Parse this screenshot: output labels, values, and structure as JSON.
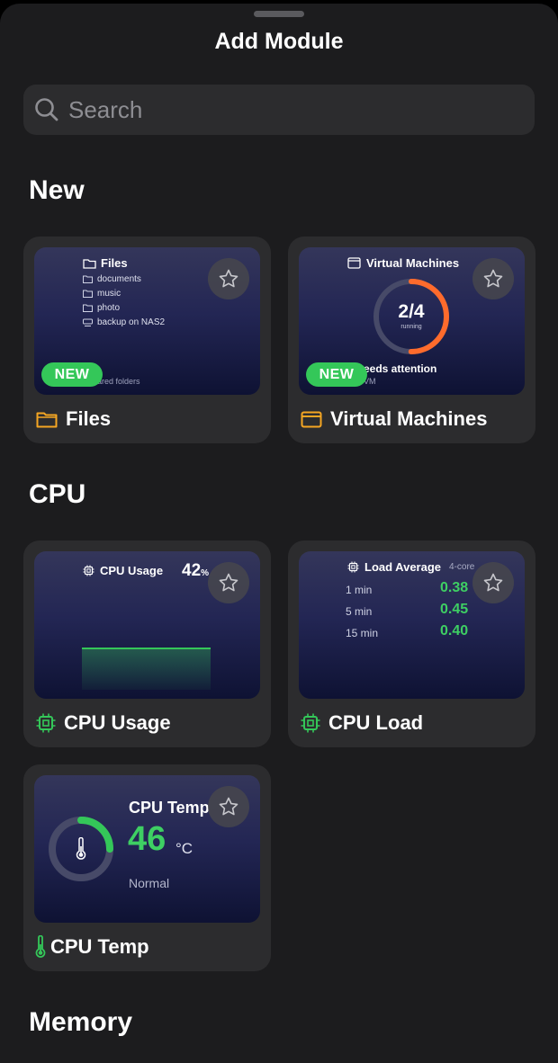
{
  "sheet": {
    "title": "Add Module"
  },
  "search": {
    "placeholder": "Search"
  },
  "sections": {
    "new": "New",
    "cpu": "CPU",
    "memory": "Memory"
  },
  "badges": {
    "new": "NEW"
  },
  "files_card": {
    "label": "Files",
    "preview_title": "Files",
    "folders": [
      "documents",
      "music",
      "photo",
      "backup on NAS2"
    ],
    "footer": "ared folders",
    "icon": "folder-icon"
  },
  "vm_card": {
    "label": "Virtual Machines",
    "preview_title": "Virtual Machines",
    "ring_value": "2/4",
    "ring_caption": "running",
    "ring_fraction": 0.5,
    "status_text": "eeds attention",
    "status_sub": "VM",
    "icon": "window-icon"
  },
  "cpu_usage_card": {
    "label": "CPU Usage",
    "preview_title": "CPU Usage",
    "value": "42",
    "unit": "%",
    "icon": "chip-icon"
  },
  "cpu_load_card": {
    "label": "CPU Load",
    "preview_title": "Load Average",
    "cores": "4-core",
    "rows": [
      {
        "label": "1 min",
        "value": "0.38"
      },
      {
        "label": "5 min",
        "value": "0.45"
      },
      {
        "label": "15 min",
        "value": "0.40"
      }
    ],
    "icon": "chip-icon"
  },
  "cpu_temp_card": {
    "label": "CPU Temp",
    "preview_title": "CPU Temp",
    "value": "46",
    "unit": "°C",
    "status": "Normal",
    "gauge_fraction": 0.25,
    "icon": "thermometer-icon"
  },
  "colors": {
    "accent_green": "#34c759",
    "value_green": "#3ecf63",
    "folder_orange": "#f5a623",
    "ring_orange": "#ff6b2c"
  }
}
